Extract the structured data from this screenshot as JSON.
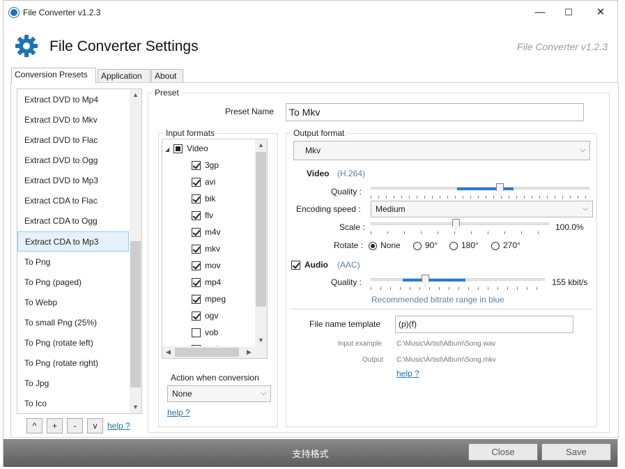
{
  "window": {
    "title": "File Converter v1.2.3",
    "minimize": "—",
    "maximize": "☐",
    "close": "✕"
  },
  "header": {
    "title": "File Converter Settings",
    "version": "File Converter v1.2.3",
    "icon": "gear-icon",
    "icon_color": "#1e73b8"
  },
  "tabs": [
    {
      "label": "Conversion Presets",
      "active": true
    },
    {
      "label": "Application",
      "active": false
    },
    {
      "label": "About",
      "active": false
    }
  ],
  "presets": {
    "items": [
      "Extract DVD to Mp4",
      "Extract DVD to Mkv",
      "Extract DVD to Flac",
      "Extract DVD to Ogg",
      "Extract DVD to Mp3",
      "Extract CDA to Flac",
      "Extract CDA to Ogg",
      "Extract CDA to Mp3",
      "To Png",
      "To Png (paged)",
      "To Webp",
      "To small Png (25%)",
      "To Png (rotate left)",
      "To Png (rotate right)",
      "To Jpg",
      "To Ico"
    ],
    "selected": "Extract CDA to Mp3",
    "buttons": {
      "up": "^",
      "add": "+",
      "remove": "-",
      "down": "v"
    },
    "help": "help ?"
  },
  "preset": {
    "group_label": "Preset",
    "name_label": "Preset Name",
    "name_value": "To Mkv"
  },
  "input_formats": {
    "group_label": "Input formats",
    "category": "Video",
    "items": [
      {
        "label": "3gp",
        "checked": true
      },
      {
        "label": "avi",
        "checked": true
      },
      {
        "label": "bik",
        "checked": true
      },
      {
        "label": "flv",
        "checked": true
      },
      {
        "label": "m4v",
        "checked": true
      },
      {
        "label": "mkv",
        "checked": true
      },
      {
        "label": "mov",
        "checked": true
      },
      {
        "label": "mp4",
        "checked": true
      },
      {
        "label": "mpeg",
        "checked": true
      },
      {
        "label": "ogv",
        "checked": true
      },
      {
        "label": "vob",
        "checked": false
      },
      {
        "label": "webm",
        "checked": true
      }
    ],
    "action_label": "Action when conversion",
    "action_value": "None",
    "help": "help ?"
  },
  "output_format": {
    "group_label": "Output format",
    "format_value": "Mkv",
    "video_label": "Video",
    "video_codec": "(H.264)",
    "quality_label": "Quality :",
    "quality_level": 0.49,
    "encoding_speed_label": "Encoding speed :",
    "encoding_speed_value": "Medium",
    "scale_label": "Scale :",
    "scale_value": "100.0%",
    "scale_level": 0.48,
    "rotate_label": "Rotate :",
    "rotate_options": [
      "None",
      "90°",
      "180°",
      "270°"
    ],
    "rotate_selected": "None",
    "audio_label": "Audio",
    "audio_codec": "(AAC)",
    "audio_enabled": true,
    "audio_quality_label": "Quality :",
    "audio_quality_value": "155 kbit/s",
    "audio_quality_level": 0.31,
    "bitrate_hint": "Recommended bitrate range in blue",
    "template_label": "File name template",
    "template_value": "(p)(f)",
    "input_example_label": "Input example",
    "input_example_value": "C:\\Music\\Artist\\Album\\Song.wav",
    "output_label": "Output",
    "output_value": "C:\\Music\\Artist\\Album\\Song.mkv",
    "help": "help ?"
  },
  "footer": {
    "label": "支持格式",
    "close": "Close",
    "save": "Save"
  },
  "colors": {
    "accent": "#2b7bd3",
    "link": "#1a6fb5",
    "selection": "#e5f1fb"
  }
}
